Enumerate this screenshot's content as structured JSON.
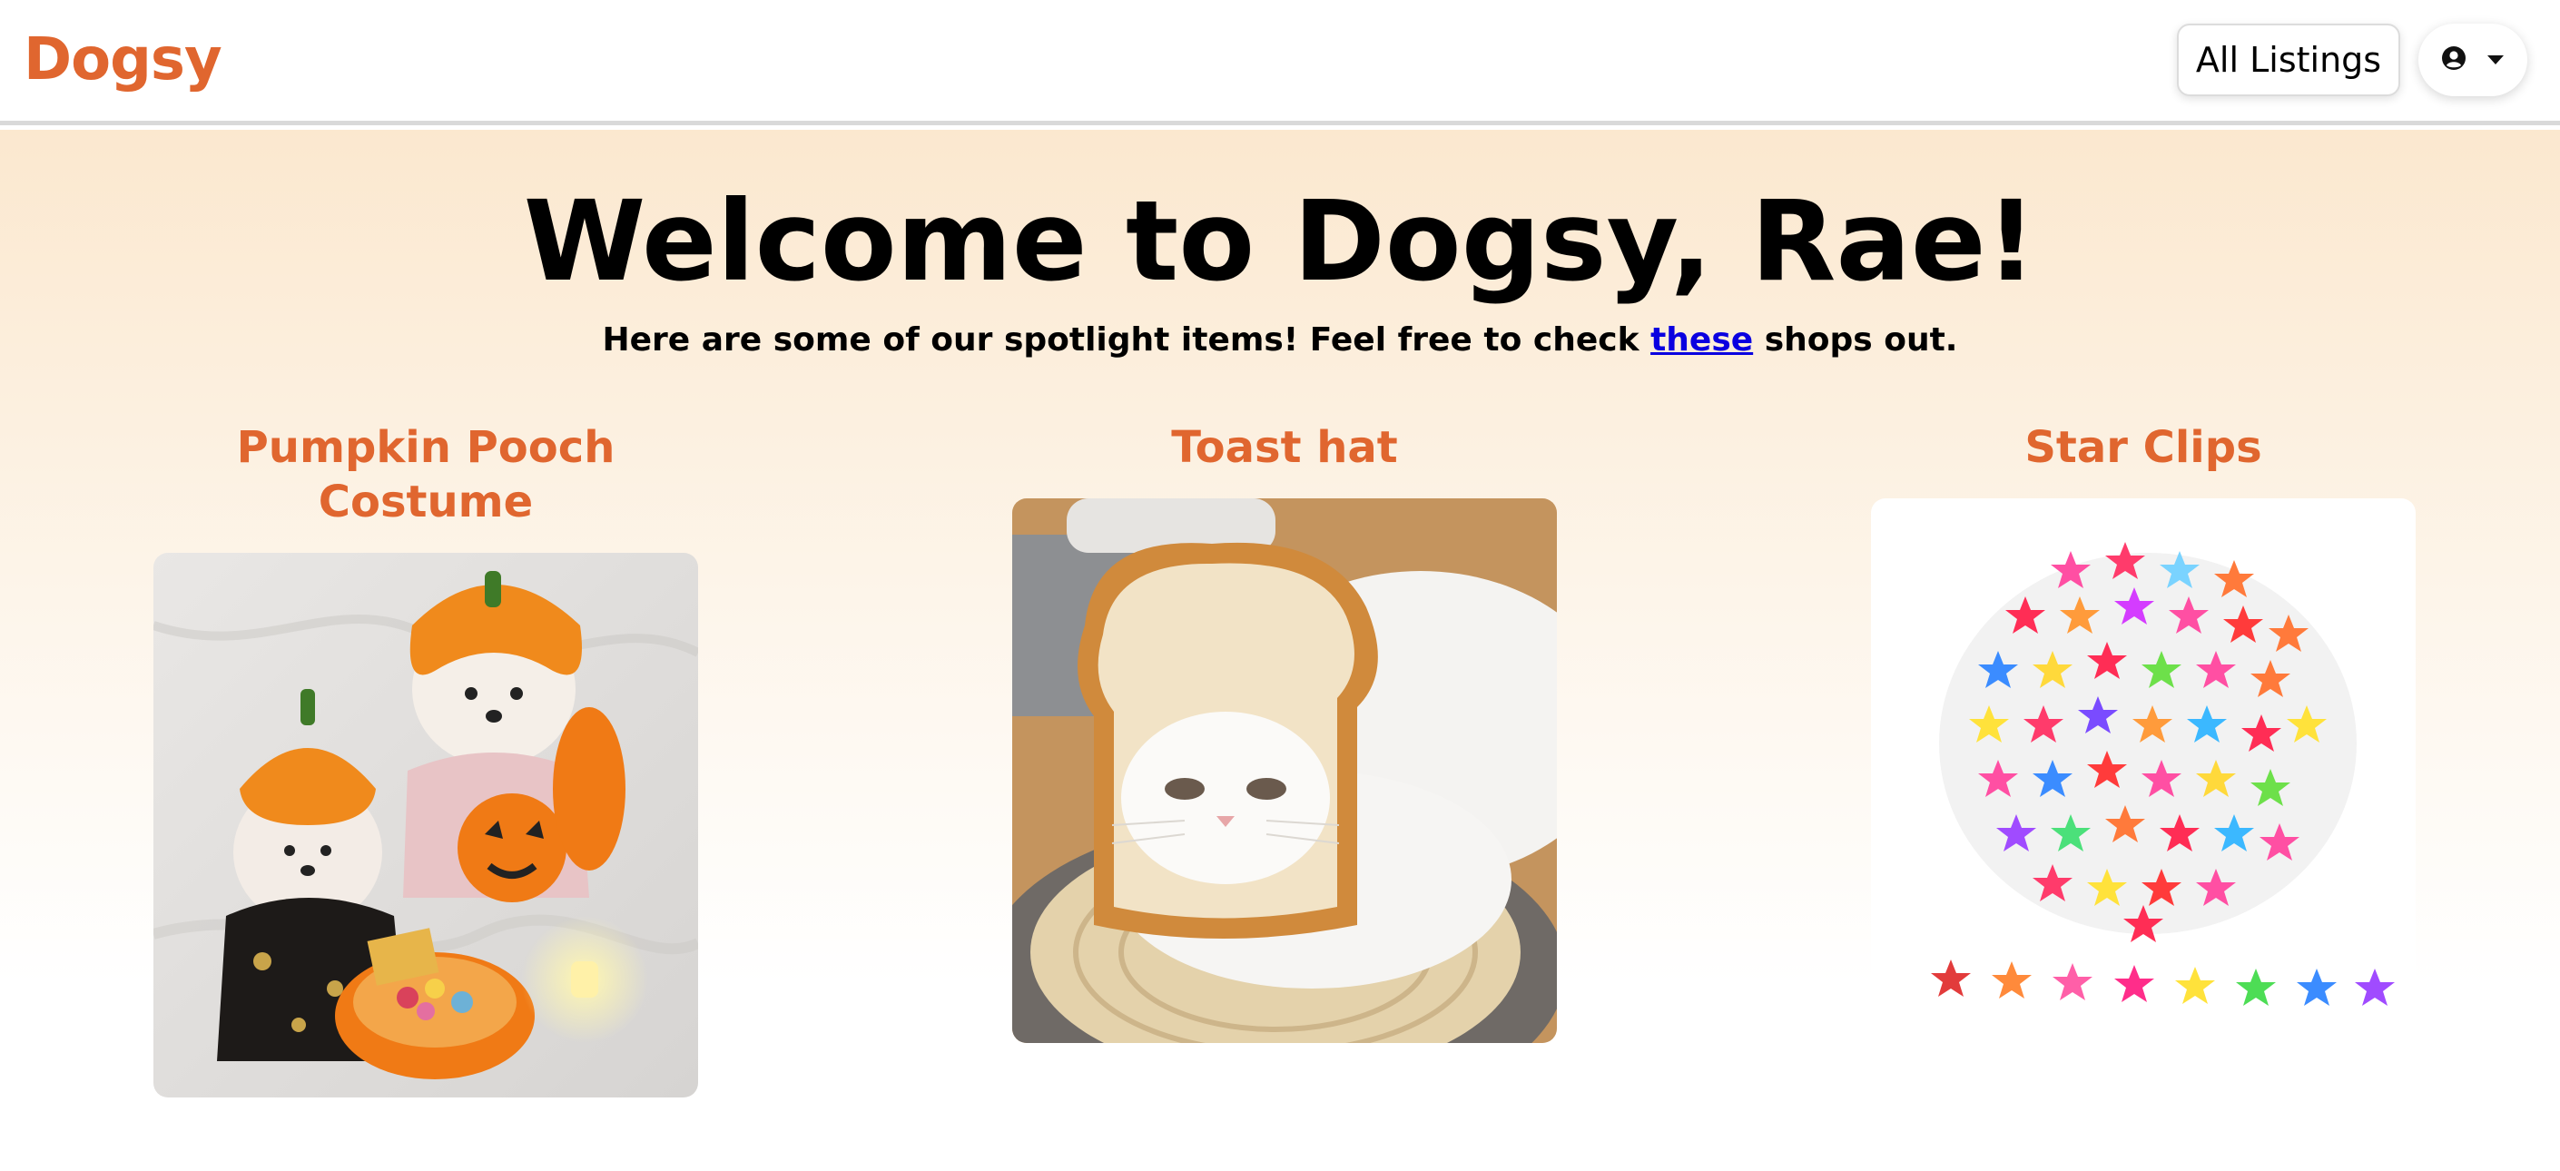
{
  "nav": {
    "brand": "Dogsy",
    "all_listings_label": "All Listings",
    "profile_icon": "user-circle-icon",
    "caret_icon": "caret-down-icon"
  },
  "hero": {
    "title": "Welcome to Dogsy, Rae!",
    "subtitle_before": "Here are some of our spotlight items! Feel free to check ",
    "subtitle_link": "these",
    "subtitle_after": " shops out."
  },
  "spotlight": [
    {
      "title": "Pumpkin Pooch Costume"
    },
    {
      "title": "Toast hat"
    },
    {
      "title": "Star Clips"
    }
  ],
  "colors": {
    "brand": "#e0662f",
    "link": "#0a00e0",
    "hero_top": "#fbe8cf"
  }
}
